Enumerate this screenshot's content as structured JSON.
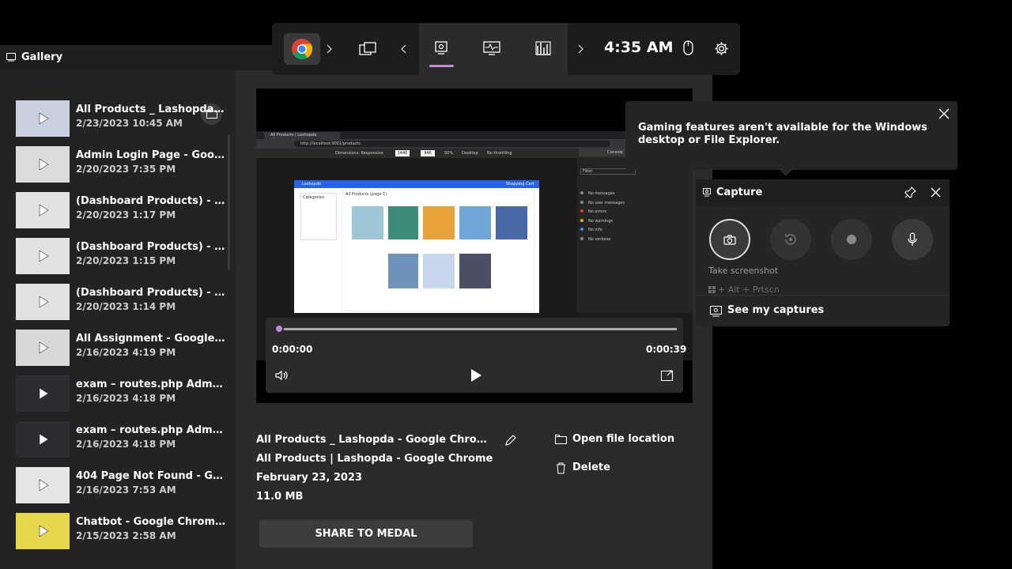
{
  "gallery": {
    "title": "Gallery",
    "items": [
      {
        "title": "All Products _ Lashopda - G...",
        "date": "2/23/2023 10:45 AM",
        "thumb": "#c9d0df"
      },
      {
        "title": "Admin Login Page - Google...",
        "date": "2/20/2023 7:35 PM",
        "thumb": "#dcdcdc"
      },
      {
        "title": "(Dashboard Products) - Goo...",
        "date": "2/20/2023 1:17 PM",
        "thumb": "#e2e2e2"
      },
      {
        "title": "(Dashboard Products) - Goo...",
        "date": "2/20/2023 1:15 PM",
        "thumb": "#e2e2e2"
      },
      {
        "title": "(Dashboard Products) - Goo...",
        "date": "2/20/2023 1:14 PM",
        "thumb": "#e2e2e2"
      },
      {
        "title": "All Assignment - Google Ch...",
        "date": "2/16/2023 4:19 PM",
        "thumb": "#d8d8d8"
      },
      {
        "title": "exam – routes.php Administ...",
        "date": "2/16/2023 4:18 PM",
        "thumb": "#2b2d31"
      },
      {
        "title": "exam – routes.php Administ...",
        "date": "2/16/2023 4:18 PM",
        "thumb": "#2b2d31"
      },
      {
        "title": "404 Page Not Found - Googl...",
        "date": "2/16/2023 7:53 AM",
        "thumb": "#e5e5e5"
      },
      {
        "title": "Chatbot - Google Chrome 2...",
        "date": "2/15/2023 2:58 AM",
        "thumb": "#e6d84a"
      }
    ]
  },
  "player": {
    "current_time": "0:00:00",
    "total_time": "0:00:39",
    "progress": 0
  },
  "details": {
    "filename": "All Products _ Lashopda - Google Chrome 202...",
    "window_title": "All Products | Lashopda - Google Chrome",
    "date": "February 23, 2023",
    "size": "11.0 MB",
    "open_location": "Open file location",
    "delete": "Delete",
    "share": "SHARE TO MEDAL"
  },
  "topbar": {
    "clock": "4:35 AM"
  },
  "notice": {
    "text": "Gaming features aren't available for the Windows desktop or File Explorer."
  },
  "capture": {
    "title": "Capture",
    "take_screenshot": "Take screenshot",
    "shortcut": "+ Alt + Prtscn",
    "see_captures": "See my captures"
  },
  "preview": {
    "tab_title": "All Products | Lashopda",
    "url": "http://localhost:9001/products",
    "site_name": "Lashopda",
    "cart": "Shopping Cart (4)",
    "heading": "All Products (page 1)",
    "categories": "Categories",
    "console_tab": "Console",
    "filter": "Filter",
    "console_items": [
      "No messages",
      "No user messages",
      "No errors",
      "No warnings",
      "No info",
      "No verbose"
    ],
    "dims": "Dimensions: Responsive",
    "w": "1440",
    "h": "946",
    "zoom": "50%",
    "device": "Desktop",
    "throttle": "No throttling"
  }
}
